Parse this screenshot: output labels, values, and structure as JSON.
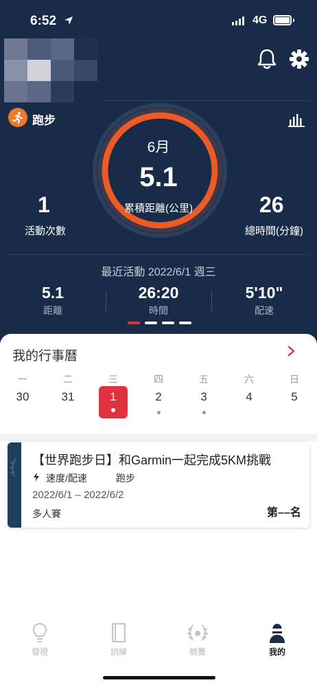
{
  "status_bar": {
    "time": "6:52",
    "network": "4G"
  },
  "header": {
    "sport": "跑步"
  },
  "summary": {
    "month": "6月",
    "total_distance": "5.1",
    "total_distance_label": "累積距離(公里)",
    "activity_count": "1",
    "activity_count_label": "活動次數",
    "total_time": "26",
    "total_time_label": "總時間(分鐘)"
  },
  "recent": {
    "title": "最近活動 2022/6/1 週三",
    "metrics": [
      {
        "value": "5.1",
        "label": "距離"
      },
      {
        "value": "26:20",
        "label": "時間"
      },
      {
        "value": "5'10\"",
        "label": "配速"
      }
    ],
    "page_count": 4,
    "active_page": 1
  },
  "calendar": {
    "title": "我的行事曆",
    "weekdays": [
      "一",
      "二",
      "三",
      "四",
      "五",
      "六",
      "日"
    ],
    "days": [
      "30",
      "31",
      "1",
      "2",
      "3",
      "4",
      "5"
    ],
    "today_index": 2,
    "event_days": [
      3,
      4
    ]
  },
  "challenge": {
    "title": "【世界跑步日】和Garmin一起完成5KM挑戰",
    "tag_speed": "速度/配速",
    "tag_sport": "跑步",
    "date_range": "2022/6/1 – 2022/6/2",
    "type": "多人賽",
    "rank": "第––名"
  },
  "tabs": [
    {
      "label": "發現",
      "icon": "lightbulb-icon",
      "active": false
    },
    {
      "label": "訓練",
      "icon": "book-icon",
      "active": false
    },
    {
      "label": "競賽",
      "icon": "laurel-icon",
      "active": false
    },
    {
      "label": "我的",
      "icon": "profile-icon",
      "active": true
    }
  ],
  "colors": {
    "header_bg": "#182c4a",
    "accent": "#e0313f",
    "ring": "#ee5a24",
    "sport_icon": "#ef7b2a"
  }
}
